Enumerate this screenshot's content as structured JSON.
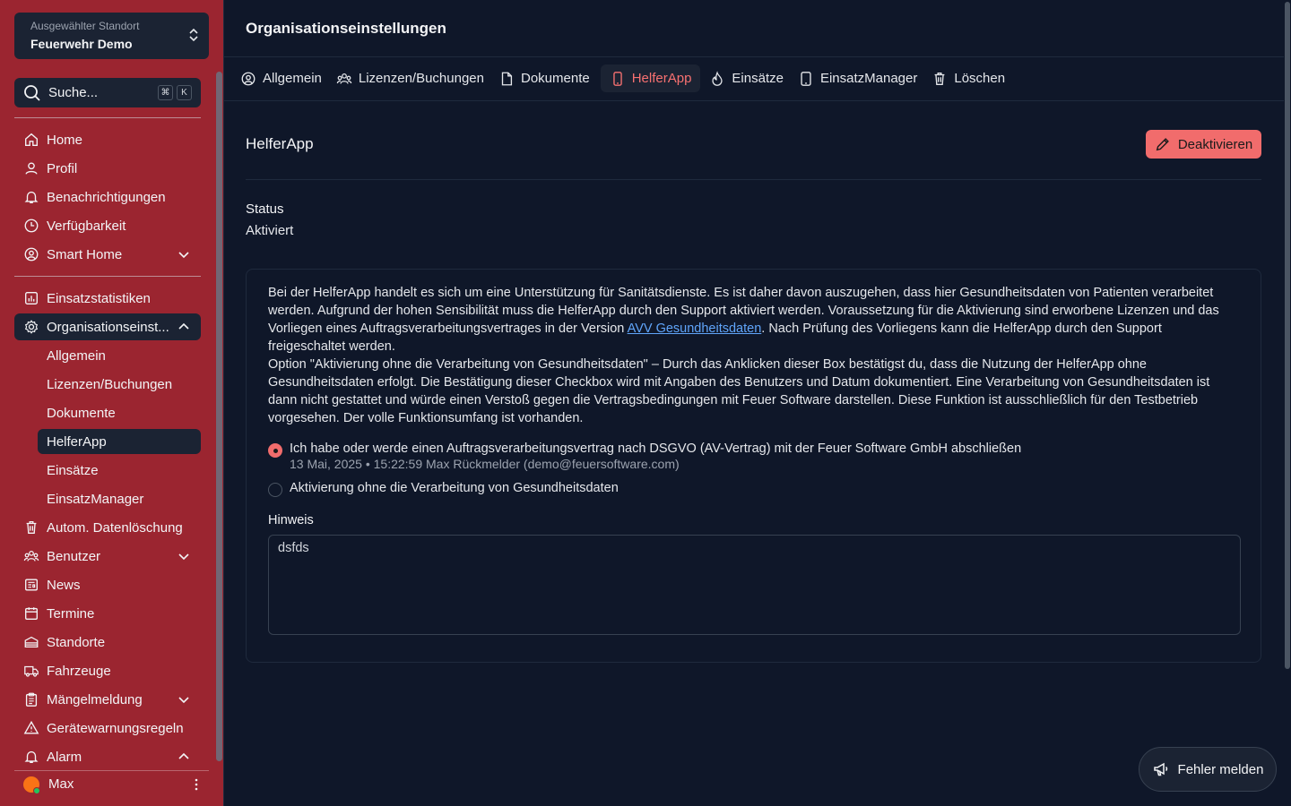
{
  "sidebar": {
    "location": {
      "label": "Ausgewählter Standort",
      "value": "Feuerwehr Demo"
    },
    "search": {
      "placeholder": "Suche...",
      "key1": "⌘",
      "key2": "K"
    },
    "nav": [
      {
        "label": "Home",
        "icon": "home-icon"
      },
      {
        "label": "Profil",
        "icon": "user-icon"
      },
      {
        "label": "Benachrichtigungen",
        "icon": "bell-icon"
      },
      {
        "label": "Verfügbarkeit",
        "icon": "clock-icon"
      },
      {
        "label": "Smart Home",
        "icon": "user-circle-icon"
      },
      {
        "label": "Einsatzstatistiken",
        "icon": "chart-icon"
      },
      {
        "label": "Organisationseinst...",
        "icon": "gear-icon"
      },
      {
        "label": "Autom. Datenlöschung",
        "icon": "trash-icon"
      },
      {
        "label": "Benutzer",
        "icon": "users-icon"
      },
      {
        "label": "News",
        "icon": "newspaper-icon"
      },
      {
        "label": "Termine",
        "icon": "calendar-icon"
      },
      {
        "label": "Standorte",
        "icon": "building-icon"
      },
      {
        "label": "Fahrzeuge",
        "icon": "truck-icon"
      },
      {
        "label": "Mängelmeldung",
        "icon": "clipboard-icon"
      },
      {
        "label": "Gerätewarnungsregeln",
        "icon": "warning-icon"
      },
      {
        "label": "Alarm",
        "icon": "bell-icon"
      }
    ],
    "sub": [
      "Allgemein",
      "Lizenzen/Buchungen",
      "Dokumente",
      "HelferApp",
      "Einsätze",
      "EinsatzManager"
    ],
    "user": "Max"
  },
  "main": {
    "title": "Organisationseinstellungen",
    "tabs": [
      "Allgemein",
      "Lizenzen/Buchungen",
      "Dokumente",
      "HelferApp",
      "Einsätze",
      "EinsatzManager",
      "Löschen"
    ],
    "section_title": "HelferApp",
    "deactivate_label": "Deaktivieren",
    "status_label": "Status",
    "status_value": "Aktiviert",
    "info_p1_a": "Bei der HelferApp handelt es sich um eine Unterstützung für Sanitätsdienste. Es ist daher davon auszugehen, dass hier Gesundheitsdaten von Patienten verarbeitet werden. Aufgrund der hohen Sensibilität muss die HelferApp durch den Support aktiviert werden. Voraussetzung für die Aktivierung sind erworbene Lizenzen und das Vorliegen eines Auftragsverarbeitungsvertrages in der Version ",
    "info_link": "AVV Gesundheitsdaten",
    "info_p1_b": ". Nach Prüfung des Vorliegens kann die HelferApp durch den Support freigeschaltet werden.",
    "info_p2": "Option \"Aktivierung ohne die Verarbeitung von Gesundheitsdaten\" – Durch das Anklicken dieser Box bestätigst du, dass die Nutzung der HelferApp ohne Gesundheitsdaten erfolgt. Die Bestätigung dieser Checkbox wird mit Angaben des Benutzers und Datum dokumentiert. Eine Verarbeitung von Gesundheitsdaten ist dann nicht gestattet und würde einen Verstoß gegen die Vertragsbedingungen mit Feuer Software darstellen. Diese Funktion ist ausschließlich für den Testbetrieb vorgesehen. Der volle Funktionsumfang ist vorhanden.",
    "radio1_label": "Ich habe oder werde einen Auftragsverarbeitungsvertrag nach DSGVO (AV-Vertrag) mit der Feuer Software GmbH abschließen",
    "radio1_meta": "13 Mai, 2025 • 15:22:59 Max Rückmelder (demo@feuersoftware.com)",
    "radio2_label": "Aktivierung ohne die Verarbeitung von Gesundheitsdaten",
    "hint_label": "Hinweis",
    "hint_value": "dsfds",
    "report_label": "Fehler melden"
  },
  "colors": {
    "sidebar": "#9b2530",
    "accent": "#f16c6c",
    "bg": "#0f1729",
    "panel": "#1b2333"
  }
}
